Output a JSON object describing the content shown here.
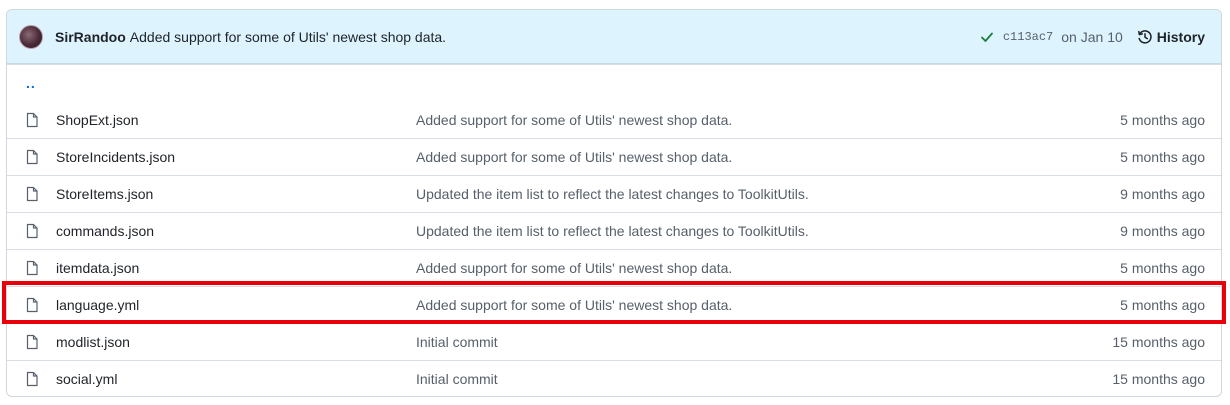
{
  "commit": {
    "author": "SirRandoo",
    "message": "Added support for some of Utils' newest shop data.",
    "sha": "c113ac7",
    "date": "on Jan 10",
    "history_label": "History",
    "status_color": "#1a7f37"
  },
  "parent_dir_label": "..",
  "files": [
    {
      "name": "ShopExt.json",
      "message": "Added support for some of Utils' newest shop data.",
      "age": "5 months ago"
    },
    {
      "name": "StoreIncidents.json",
      "message": "Added support for some of Utils' newest shop data.",
      "age": "5 months ago"
    },
    {
      "name": "StoreItems.json",
      "message": "Updated the item list to reflect the latest changes to ToolkitUtils.",
      "age": "9 months ago"
    },
    {
      "name": "commands.json",
      "message": "Updated the item list to reflect the latest changes to ToolkitUtils.",
      "age": "9 months ago"
    },
    {
      "name": "itemdata.json",
      "message": "Added support for some of Utils' newest shop data.",
      "age": "5 months ago"
    },
    {
      "name": "language.yml",
      "message": "Added support for some of Utils' newest shop data.",
      "age": "5 months ago"
    },
    {
      "name": "modlist.json",
      "message": "Initial commit",
      "age": "15 months ago"
    },
    {
      "name": "social.yml",
      "message": "Initial commit",
      "age": "15 months ago"
    }
  ],
  "highlight_color": "#e8000b",
  "icons": {
    "file": "file-icon",
    "check": "check-icon",
    "history": "history-icon"
  }
}
